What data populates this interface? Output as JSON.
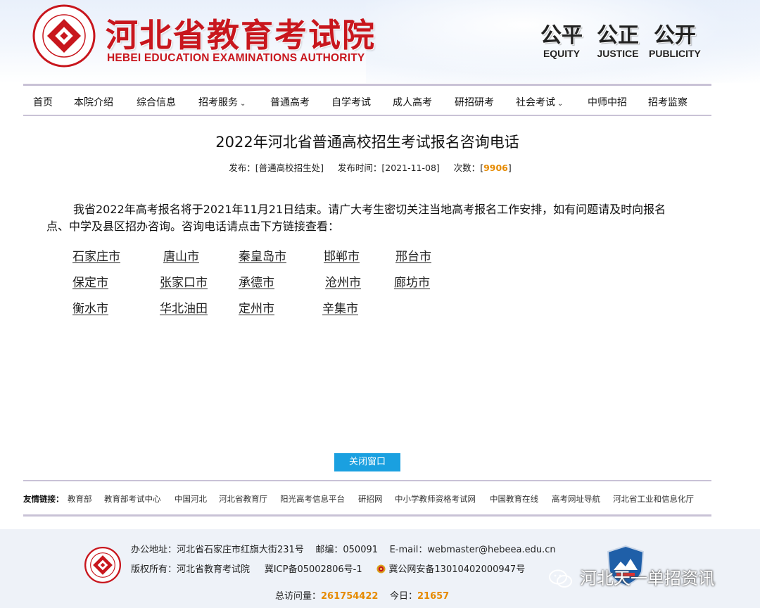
{
  "header": {
    "title": "河北省教育考试院",
    "subtitle": "HEBEI EDUCATION EXAMINATIONS AUTHORITY",
    "motto": [
      {
        "cn": "公平",
        "en": "EQUITY"
      },
      {
        "cn": "公正",
        "en": "JUSTICE"
      },
      {
        "cn": "公开",
        "en": "PUBLICITY"
      }
    ],
    "seal_text": "河北省教育考试院 HEBEI EDUCATION EXAMINATIONS AUTHORITY",
    "brand_color": "#c8161d"
  },
  "nav": {
    "items": [
      {
        "label": "首页",
        "dropdown": false
      },
      {
        "label": "本院介绍",
        "dropdown": false
      },
      {
        "label": "综合信息",
        "dropdown": false
      },
      {
        "label": "招考服务",
        "dropdown": true
      },
      {
        "label": "普通高考",
        "dropdown": false
      },
      {
        "label": "自学考试",
        "dropdown": false
      },
      {
        "label": "成人高考",
        "dropdown": false
      },
      {
        "label": "研招研考",
        "dropdown": false
      },
      {
        "label": "社会考试",
        "dropdown": true
      },
      {
        "label": "中师中招",
        "dropdown": false
      },
      {
        "label": "招考监察",
        "dropdown": false
      }
    ],
    "dropdown_icon": "chevron-down-icon"
  },
  "article": {
    "title": "2022年河北省普通高校招生考试报名咨询电话",
    "meta": {
      "publisher_label": "发布：",
      "publisher": "[普通高校招生处]",
      "time_label": "发布时间：",
      "time": "[2021-11-08]",
      "count_label": "次数：",
      "count_open": "[",
      "count": "9906",
      "count_close": "]"
    },
    "body": "我省2022年高考报名将于2021年11月21日结束。请广大考生密切关注当地高考报名工作安排，如有问题请及时向报名点、中学及县区招办咨询。咨询电话请点击下方链接查看：",
    "cities": [
      [
        "石家庄市",
        "唐山市",
        "秦皇岛市",
        "邯郸市",
        "邢台市"
      ],
      [
        "保定市",
        "张家口市",
        "承德市",
        "沧州市",
        "廊坊市"
      ],
      [
        "衡水市",
        "华北油田",
        "定州市",
        "辛集市"
      ]
    ]
  },
  "close_button": "关闭窗口",
  "friend_links": {
    "label": "友情链接：",
    "items": [
      "教育部",
      "教育部考试中心",
      "中国河北",
      "河北省教育厅",
      "阳光高考信息平台",
      "研招网",
      "中小学教师资格考试网",
      "中国教育在线",
      "高考网址导航",
      "河北省工业和信息化厅"
    ]
  },
  "footer": {
    "address_label": "办公地址：",
    "address": "河北省石家庄市红旗大街231号",
    "postcode_label": "邮编：",
    "postcode": "050091",
    "email_label": "E-mail：",
    "email": "webmaster@hebeea.edu.cn",
    "copyright_label": "版权所有：",
    "copyright": "河北省教育考试院",
    "icp": "冀ICP备05002806号-1",
    "police": "冀公网安备13010402000947号",
    "total_label": "总访问量：",
    "total": "261754422",
    "today_label": "今日：",
    "today": "21657",
    "accent_color": "#e68a00"
  },
  "watermark": {
    "text": "河北天一单招资讯",
    "icon": "wechat-icon"
  }
}
